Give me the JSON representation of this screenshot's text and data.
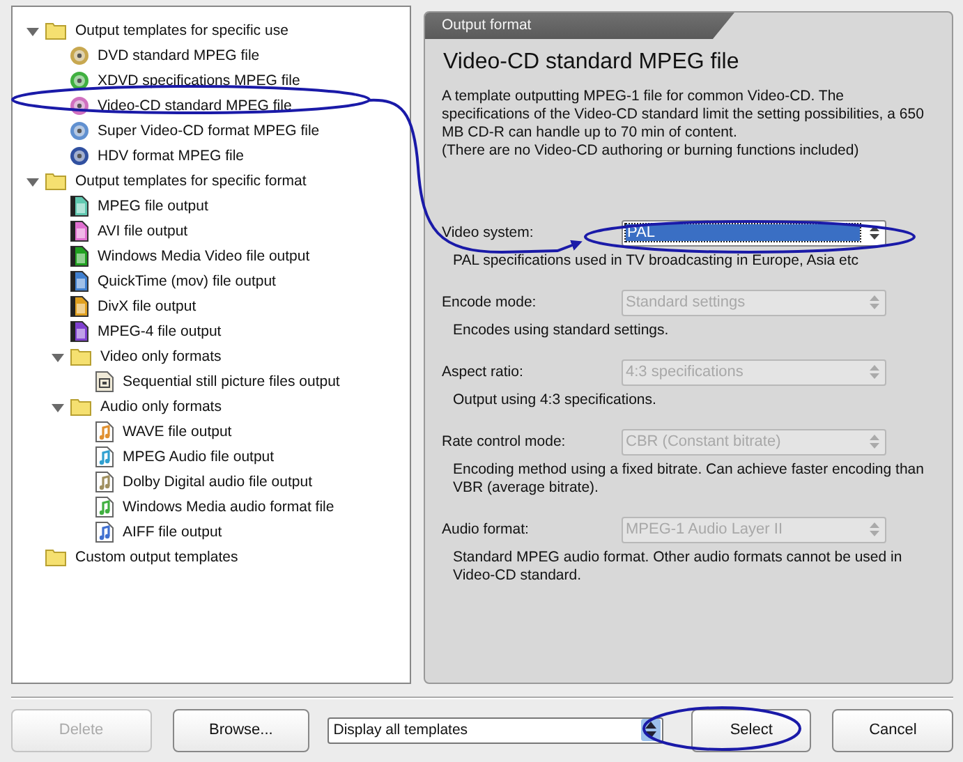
{
  "tree": [
    {
      "label": "Output templates for specific use",
      "kind": "folder",
      "children": [
        {
          "label": "DVD standard MPEG file",
          "kind": "disc",
          "color": "#c8a850"
        },
        {
          "label": "XDVD specifications MPEG file",
          "kind": "disc",
          "color": "#40b040"
        },
        {
          "label": "Video-CD standard MPEG file",
          "kind": "disc",
          "color": "#d070c0"
        },
        {
          "label": "Super Video-CD format MPEG file",
          "kind": "disc",
          "color": "#6090d0"
        },
        {
          "label": "HDV format MPEG file",
          "kind": "disc",
          "color": "#3050a0"
        }
      ]
    },
    {
      "label": "Output templates for specific format",
      "kind": "folder",
      "children": [
        {
          "label": "MPEG file output",
          "kind": "video",
          "color": "#60c8b0"
        },
        {
          "label": "AVI file output",
          "kind": "video",
          "color": "#e070d0"
        },
        {
          "label": "Windows Media Video file output",
          "kind": "video",
          "color": "#20a020"
        },
        {
          "label": "QuickTime (mov) file output",
          "kind": "video",
          "color": "#4080d0"
        },
        {
          "label": "DivX file output",
          "kind": "video",
          "color": "#e0a020"
        },
        {
          "label": "MPEG-4 file output",
          "kind": "video",
          "color": "#8040d0"
        },
        {
          "label": "Video only formats",
          "kind": "folder",
          "children": [
            {
              "label": "Sequential still picture files output",
              "kind": "still"
            }
          ]
        },
        {
          "label": "Audio only formats",
          "kind": "folder",
          "children": [
            {
              "label": "WAVE file output",
              "kind": "audio",
              "color": "#e09030"
            },
            {
              "label": "MPEG Audio file output",
              "kind": "audio",
              "color": "#30a0d0"
            },
            {
              "label": "Dolby Digital audio file output",
              "kind": "audio",
              "color": "#a09060"
            },
            {
              "label": "Windows Media audio format file",
              "kind": "audio",
              "color": "#40b040"
            },
            {
              "label": "AIFF file output",
              "kind": "audio",
              "color": "#4070d0"
            }
          ]
        }
      ]
    },
    {
      "label": "Custom output templates",
      "kind": "folder"
    }
  ],
  "panel": {
    "tab": "Output format",
    "title": "Video-CD standard MPEG file",
    "description": "A template outputting MPEG-1 file for common Video-CD. The specifications of the Video-CD standard limit the setting possibilities, a 650 MB CD-R can handle up to 70 min of content.",
    "note": "(There are no Video-CD authoring or burning functions included)",
    "fields": [
      {
        "label": "Video system:",
        "value": "PAL",
        "disabled": false,
        "focused": true,
        "description": "PAL specifications used in TV broadcasting in Europe, Asia etc"
      },
      {
        "label": "Encode mode:",
        "value": "Standard settings",
        "disabled": true,
        "focused": false,
        "description": "Encodes using standard settings."
      },
      {
        "label": "Aspect ratio:",
        "value": "4:3 specifications",
        "disabled": true,
        "focused": false,
        "description": "Output using 4:3 specifications."
      },
      {
        "label": "Rate control mode:",
        "value": "CBR (Constant bitrate)",
        "disabled": true,
        "focused": false,
        "description": "Encoding method using a fixed bitrate. Can achieve faster encoding than VBR (average bitrate)."
      },
      {
        "label": "Audio format:",
        "value": "MPEG-1 Audio Layer II",
        "disabled": true,
        "focused": false,
        "description": "Standard MPEG audio format. Other audio formats cannot be used in Video-CD standard."
      }
    ]
  },
  "footer": {
    "buttons": [
      {
        "label": "Delete",
        "disabled": true
      },
      {
        "label": "Browse...",
        "disabled": false
      }
    ],
    "filter": {
      "value": "Display all templates"
    },
    "actions": [
      {
        "label": "Select",
        "disabled": false
      },
      {
        "label": "Cancel",
        "disabled": false
      }
    ]
  }
}
